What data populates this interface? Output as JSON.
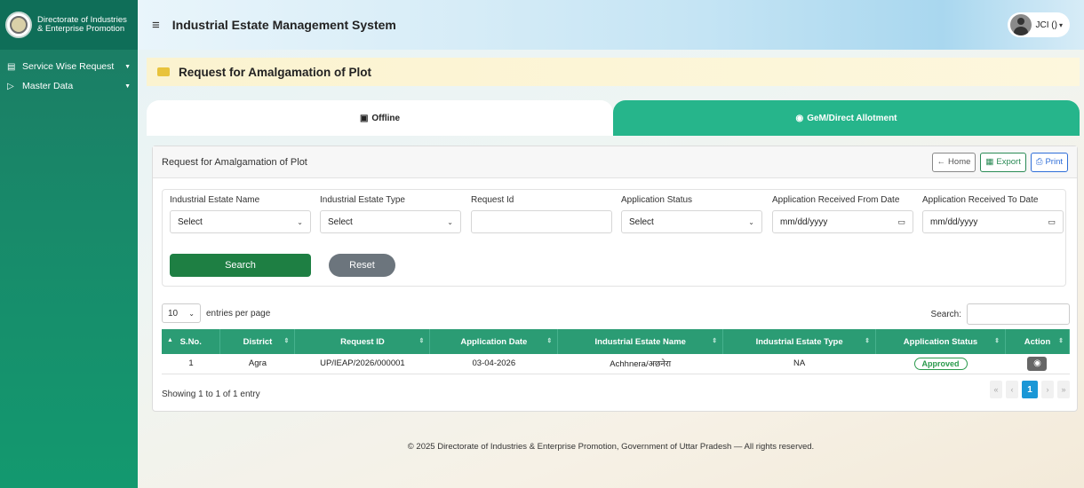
{
  "brand": {
    "line1": "Directorate of Industries",
    "line2": "& Enterprise Promotion"
  },
  "sidebar": {
    "items": [
      {
        "label": "Service Wise Request",
        "icon": "list-icon"
      },
      {
        "label": "Master Data",
        "icon": "file-icon"
      }
    ]
  },
  "topbar": {
    "title": "Industrial Estate Management System",
    "user": "JCI ()"
  },
  "page": {
    "title": "Request for Amalgamation of Plot"
  },
  "tabs": [
    {
      "label": "Offline",
      "icon": "file-icon"
    },
    {
      "label": "GeM/Direct Allotment",
      "icon": "globe-icon"
    }
  ],
  "card": {
    "title": "Request for Amalgamation of Plot",
    "home": "Home",
    "export": "Export",
    "print": "Print"
  },
  "filters": {
    "estate_name_label": "Industrial Estate Name",
    "estate_name_value": "Select",
    "estate_type_label": "Industrial Estate Type",
    "estate_type_value": "Select",
    "request_id_label": "Request Id",
    "status_label": "Application Status",
    "status_value": "Select",
    "from_date_label": "Application Received From Date",
    "from_date_value": "mm/dd/yyyy",
    "to_date_label": "Application Received To Date",
    "to_date_value": "mm/dd/yyyy",
    "search": "Search",
    "reset": "Reset"
  },
  "table": {
    "page_length": "10",
    "entries_label": "entries per page",
    "search_label": "Search:",
    "columns": [
      "S.No.",
      "District",
      "Request ID",
      "Application Date",
      "Industrial Estate Name",
      "Industrial Estate Type",
      "Application Status",
      "Action"
    ],
    "rows": [
      {
        "sno": "1",
        "district": "Agra",
        "request_id": "UP/IEAP/2026/000001",
        "date": "03-04-2026",
        "estate_name": "Achhnera/अछनेरा",
        "estate_type": "NA",
        "status": "Approved"
      }
    ],
    "showing": "Showing 1 to 1 of 1 entry",
    "pager": {
      "first": "«",
      "prev": "‹",
      "current": "1",
      "next": "›",
      "last": "»"
    }
  },
  "footer": "© 2025 Directorate of Industries & Enterprise Promotion, Government of Uttar Pradesh — All rights reserved."
}
